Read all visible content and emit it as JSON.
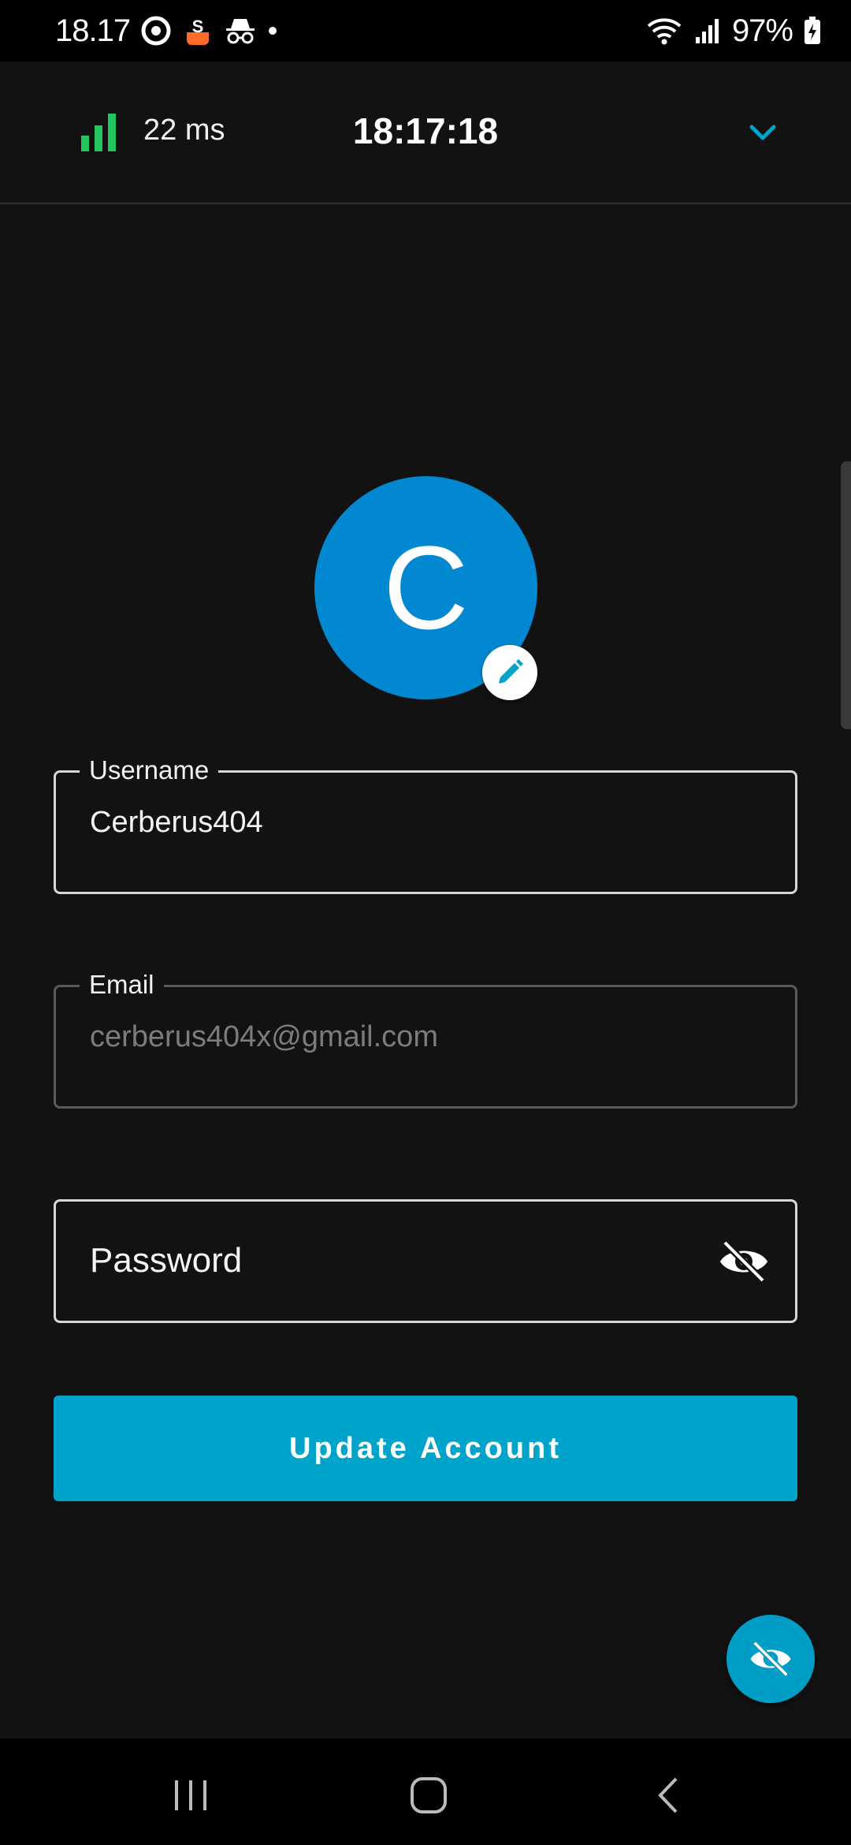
{
  "status_bar": {
    "time": "18.17",
    "battery": "97%"
  },
  "header": {
    "ping": "22 ms",
    "clock": "18:17:18"
  },
  "profile": {
    "avatar_initial": "C"
  },
  "form": {
    "username": {
      "label": "Username",
      "value": "Cerberus404"
    },
    "email": {
      "label": "Email",
      "value": "cerberus404x@gmail.com"
    },
    "password": {
      "placeholder": "Password"
    },
    "submit_label": "Update Account"
  },
  "colors": {
    "accent": "#00a3c9",
    "avatar": "#0288d1",
    "signal": "#22c55e",
    "background": "#121212"
  },
  "icons": [
    "signal-bars-icon",
    "chevron-down-icon",
    "pencil-icon",
    "eye-off-icon",
    "recents-icon",
    "home-icon",
    "back-icon"
  ]
}
